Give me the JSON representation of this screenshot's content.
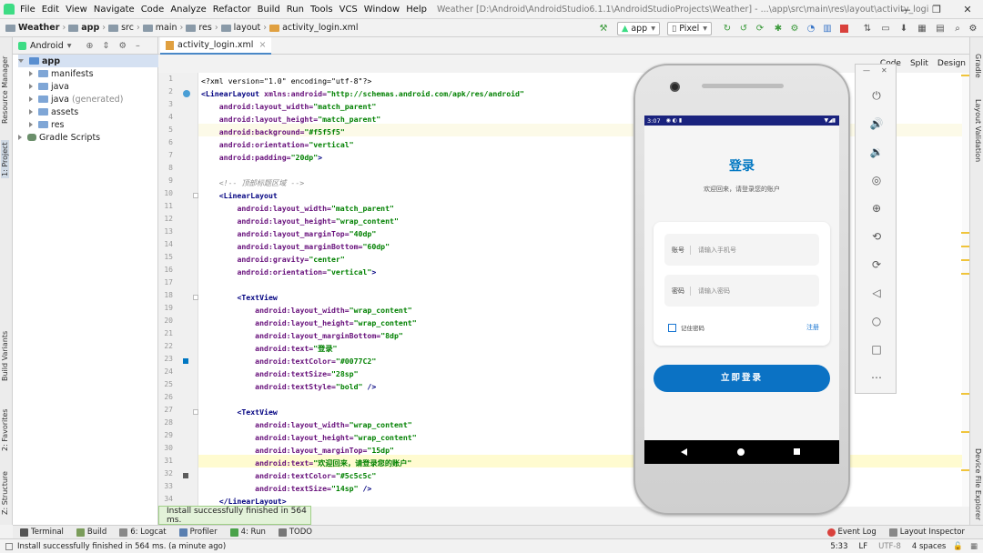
{
  "menubar": {
    "items": [
      "File",
      "Edit",
      "View",
      "Navigate",
      "Code",
      "Analyze",
      "Refactor",
      "Build",
      "Run",
      "Tools",
      "VCS",
      "Window",
      "Help"
    ],
    "window_title": "Weather [D:\\Android\\AndroidStudio6.1.1\\AndroidStudioProjects\\Weather] - ...\\app\\src\\main\\res\\layout\\activity_login.xml [app]",
    "minimize": "—",
    "maximize": "❐",
    "close": "✕"
  },
  "navbar": {
    "crumbs": [
      "Weather",
      "app",
      "src",
      "main",
      "res",
      "layout",
      "activity_login.xml"
    ],
    "run_config": "app",
    "device": "Pixel"
  },
  "toolwindow": {
    "project_view": "Android",
    "left_labels": [
      "Resource Manager",
      "1: Project",
      "Build Variants",
      "2: Favorites",
      "Z: Structure"
    ],
    "right_labels": [
      "Gradle",
      "Layout Validation",
      "Device File Explorer"
    ]
  },
  "tabs": {
    "file_tab": "activity_login.xml",
    "view_modes": [
      "Code",
      "Split",
      "Design"
    ]
  },
  "project_tree": {
    "root": "app",
    "children": [
      {
        "label": "manifests",
        "note": ""
      },
      {
        "label": "java",
        "note": ""
      },
      {
        "label": "java",
        "note": "(generated)"
      },
      {
        "label": "assets",
        "note": ""
      },
      {
        "label": "res",
        "note": ""
      }
    ],
    "gradle": "Gradle Scripts"
  },
  "editor": {
    "line_numbers": [
      "1",
      "2",
      "3",
      "4",
      "5",
      "6",
      "7",
      "8",
      "9",
      "10",
      "11",
      "12",
      "13",
      "14",
      "15",
      "16",
      "17",
      "18",
      "19",
      "20",
      "21",
      "22",
      "23",
      "24",
      "25",
      "26",
      "27",
      "28",
      "29",
      "30",
      "31",
      "32",
      "33",
      "34"
    ],
    "code_lines": [
      [
        {
          "t": "pi",
          "v": "<?xml version=\"1.0\" encoding=\"utf-8\"?>"
        }
      ],
      [
        {
          "t": "tag",
          "v": "<LinearLayout "
        },
        {
          "t": "attr",
          "v": "xmlns:android="
        },
        {
          "t": "val",
          "v": "\"http://schemas.android.com/apk/res/android\""
        }
      ],
      [
        {
          "t": "sp",
          "v": "    "
        },
        {
          "t": "attr",
          "v": "android:layout_width="
        },
        {
          "t": "val",
          "v": "\"match_parent\""
        }
      ],
      [
        {
          "t": "sp",
          "v": "    "
        },
        {
          "t": "attr",
          "v": "android:layout_height="
        },
        {
          "t": "val",
          "v": "\"match_parent\""
        }
      ],
      [
        {
          "t": "sp",
          "v": "    "
        },
        {
          "t": "attr",
          "v": "android:background="
        },
        {
          "t": "val",
          "v": "\"#f5f5f5\""
        }
      ],
      [
        {
          "t": "sp",
          "v": "    "
        },
        {
          "t": "attr",
          "v": "android:orientation="
        },
        {
          "t": "val",
          "v": "\"vertical\""
        }
      ],
      [
        {
          "t": "sp",
          "v": "    "
        },
        {
          "t": "attr",
          "v": "android:padding="
        },
        {
          "t": "val",
          "v": "\"20dp\""
        },
        {
          "t": "tag",
          "v": ">"
        }
      ],
      [],
      [
        {
          "t": "sp",
          "v": "    "
        },
        {
          "t": "cmt",
          "v": "<!-- 顶部标题区域 -->"
        }
      ],
      [
        {
          "t": "sp",
          "v": "    "
        },
        {
          "t": "tag",
          "v": "<LinearLayout"
        }
      ],
      [
        {
          "t": "sp",
          "v": "        "
        },
        {
          "t": "attr",
          "v": "android:layout_width="
        },
        {
          "t": "val",
          "v": "\"match_parent\""
        }
      ],
      [
        {
          "t": "sp",
          "v": "        "
        },
        {
          "t": "attr",
          "v": "android:layout_height="
        },
        {
          "t": "val",
          "v": "\"wrap_content\""
        }
      ],
      [
        {
          "t": "sp",
          "v": "        "
        },
        {
          "t": "attr",
          "v": "android:layout_marginTop="
        },
        {
          "t": "val",
          "v": "\"40dp\""
        }
      ],
      [
        {
          "t": "sp",
          "v": "        "
        },
        {
          "t": "attr",
          "v": "android:layout_marginBottom="
        },
        {
          "t": "val",
          "v": "\"60dp\""
        }
      ],
      [
        {
          "t": "sp",
          "v": "        "
        },
        {
          "t": "attr",
          "v": "android:gravity="
        },
        {
          "t": "val",
          "v": "\"center\""
        }
      ],
      [
        {
          "t": "sp",
          "v": "        "
        },
        {
          "t": "attr",
          "v": "android:orientation="
        },
        {
          "t": "val",
          "v": "\"vertical\""
        },
        {
          "t": "tag",
          "v": ">"
        }
      ],
      [],
      [
        {
          "t": "sp",
          "v": "        "
        },
        {
          "t": "tag",
          "v": "<TextView"
        }
      ],
      [
        {
          "t": "sp",
          "v": "            "
        },
        {
          "t": "attr",
          "v": "android:layout_width="
        },
        {
          "t": "val",
          "v": "\"wrap_content\""
        }
      ],
      [
        {
          "t": "sp",
          "v": "            "
        },
        {
          "t": "attr",
          "v": "android:layout_height="
        },
        {
          "t": "val",
          "v": "\"wrap_content\""
        }
      ],
      [
        {
          "t": "sp",
          "v": "            "
        },
        {
          "t": "attr",
          "v": "android:layout_marginBottom="
        },
        {
          "t": "val",
          "v": "\"8dp\""
        }
      ],
      [
        {
          "t": "sp",
          "v": "            "
        },
        {
          "t": "attr",
          "v": "android:text="
        },
        {
          "t": "val",
          "v": "\"登录\""
        }
      ],
      [
        {
          "t": "sp",
          "v": "            "
        },
        {
          "t": "attr",
          "v": "android:textColor="
        },
        {
          "t": "val",
          "v": "\"#0077C2\""
        }
      ],
      [
        {
          "t": "sp",
          "v": "            "
        },
        {
          "t": "attr",
          "v": "android:textSize="
        },
        {
          "t": "val",
          "v": "\"28sp\""
        }
      ],
      [
        {
          "t": "sp",
          "v": "            "
        },
        {
          "t": "attr",
          "v": "android:textStyle="
        },
        {
          "t": "val",
          "v": "\"bold\""
        },
        {
          "t": "tag",
          "v": " />"
        }
      ],
      [],
      [
        {
          "t": "sp",
          "v": "        "
        },
        {
          "t": "tag",
          "v": "<TextView"
        }
      ],
      [
        {
          "t": "sp",
          "v": "            "
        },
        {
          "t": "attr",
          "v": "android:layout_width="
        },
        {
          "t": "val",
          "v": "\"wrap_content\""
        }
      ],
      [
        {
          "t": "sp",
          "v": "            "
        },
        {
          "t": "attr",
          "v": "android:layout_height="
        },
        {
          "t": "val",
          "v": "\"wrap_content\""
        }
      ],
      [
        {
          "t": "sp",
          "v": "            "
        },
        {
          "t": "attr",
          "v": "android:layout_marginTop="
        },
        {
          "t": "val",
          "v": "\"15dp\""
        }
      ],
      [
        {
          "t": "sp",
          "v": "            "
        },
        {
          "t": "attr",
          "v": "android:text="
        },
        {
          "t": "val",
          "v": "\"欢迎回来，请登录您的账户\""
        }
      ],
      [
        {
          "t": "sp",
          "v": "            "
        },
        {
          "t": "attr",
          "v": "android:textColor="
        },
        {
          "t": "val",
          "v": "\"#5c5c5c\""
        }
      ],
      [
        {
          "t": "sp",
          "v": "            "
        },
        {
          "t": "attr",
          "v": "android:textSize="
        },
        {
          "t": "val",
          "v": "\"14sp\""
        },
        {
          "t": "tag",
          "v": " />"
        }
      ],
      [
        {
          "t": "sp",
          "v": "    "
        },
        {
          "t": "tag",
          "v": "</LinearLayout>"
        }
      ]
    ]
  },
  "phone": {
    "time": "3:07",
    "title": "登录",
    "subtitle": "欢迎回来，请登录您的账户",
    "account_label": "账号",
    "account_placeholder": "请输入手机号",
    "password_label": "密码",
    "password_placeholder": "请输入密码",
    "remember": "记住密码",
    "register": "注册",
    "login_button": "立即登录"
  },
  "toast": "Install successfully finished in 564 ms.",
  "bottom_tabs": [
    "Terminal",
    "Build",
    "6: Logcat",
    "Profiler",
    "4: Run",
    "TODO"
  ],
  "bottom_right": [
    "Event Log",
    "Layout Inspector"
  ],
  "status": {
    "message": "Install successfully finished in 564 ms. (a minute ago)",
    "position": "5:33",
    "line_sep": "LF",
    "encoding": "UTF-8",
    "indent": "4 spaces"
  },
  "colors": {
    "title_blue": "#0077c2",
    "button_blue": "#0b72c4",
    "status_bar": "#1a237e"
  }
}
